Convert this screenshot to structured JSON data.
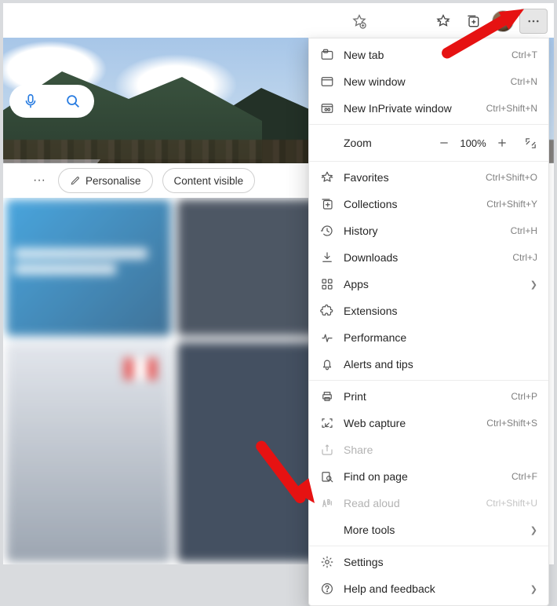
{
  "toolbar": {
    "icons": [
      "add-favorite",
      "favorites",
      "collections",
      "profile",
      "more"
    ]
  },
  "chips": {
    "more": "···",
    "personalise": "Personalise",
    "content_visible": "Content visible"
  },
  "zoom": {
    "label": "Zoom",
    "value": "100%"
  },
  "menu": [
    {
      "id": "new-tab",
      "icon": "tab",
      "label": "New tab",
      "shortcut": "Ctrl+T"
    },
    {
      "id": "new-window",
      "icon": "window",
      "label": "New window",
      "shortcut": "Ctrl+N"
    },
    {
      "id": "new-inprivate",
      "icon": "inprivate",
      "label": "New InPrivate window",
      "shortcut": "Ctrl+Shift+N"
    },
    {
      "sep": true
    },
    {
      "zoom": true
    },
    {
      "sep": true
    },
    {
      "id": "favorites",
      "icon": "fav",
      "label": "Favorites",
      "shortcut": "Ctrl+Shift+O"
    },
    {
      "id": "collections",
      "icon": "coll",
      "label": "Collections",
      "shortcut": "Ctrl+Shift+Y"
    },
    {
      "id": "history",
      "icon": "hist",
      "label": "History",
      "shortcut": "Ctrl+H"
    },
    {
      "id": "downloads",
      "icon": "down",
      "label": "Downloads",
      "shortcut": "Ctrl+J"
    },
    {
      "id": "apps",
      "icon": "apps",
      "label": "Apps",
      "submenu": true
    },
    {
      "id": "extensions",
      "icon": "ext",
      "label": "Extensions"
    },
    {
      "id": "performance",
      "icon": "perf",
      "label": "Performance"
    },
    {
      "id": "alerts",
      "icon": "bell",
      "label": "Alerts and tips"
    },
    {
      "sep": true
    },
    {
      "id": "print",
      "icon": "print",
      "label": "Print",
      "shortcut": "Ctrl+P"
    },
    {
      "id": "web-capture",
      "icon": "capture",
      "label": "Web capture",
      "shortcut": "Ctrl+Shift+S"
    },
    {
      "id": "share",
      "icon": "share",
      "label": "Share",
      "disabled": true
    },
    {
      "id": "find",
      "icon": "find",
      "label": "Find on page",
      "shortcut": "Ctrl+F"
    },
    {
      "id": "read-aloud",
      "icon": "read",
      "label": "Read aloud",
      "shortcut": "Ctrl+Shift+U",
      "disabled": true
    },
    {
      "id": "more-tools",
      "icon": "",
      "label": "More tools",
      "submenu": true
    },
    {
      "sep": true
    },
    {
      "id": "settings",
      "icon": "gear",
      "label": "Settings"
    },
    {
      "id": "help",
      "icon": "help",
      "label": "Help and feedback",
      "submenu": true
    }
  ]
}
